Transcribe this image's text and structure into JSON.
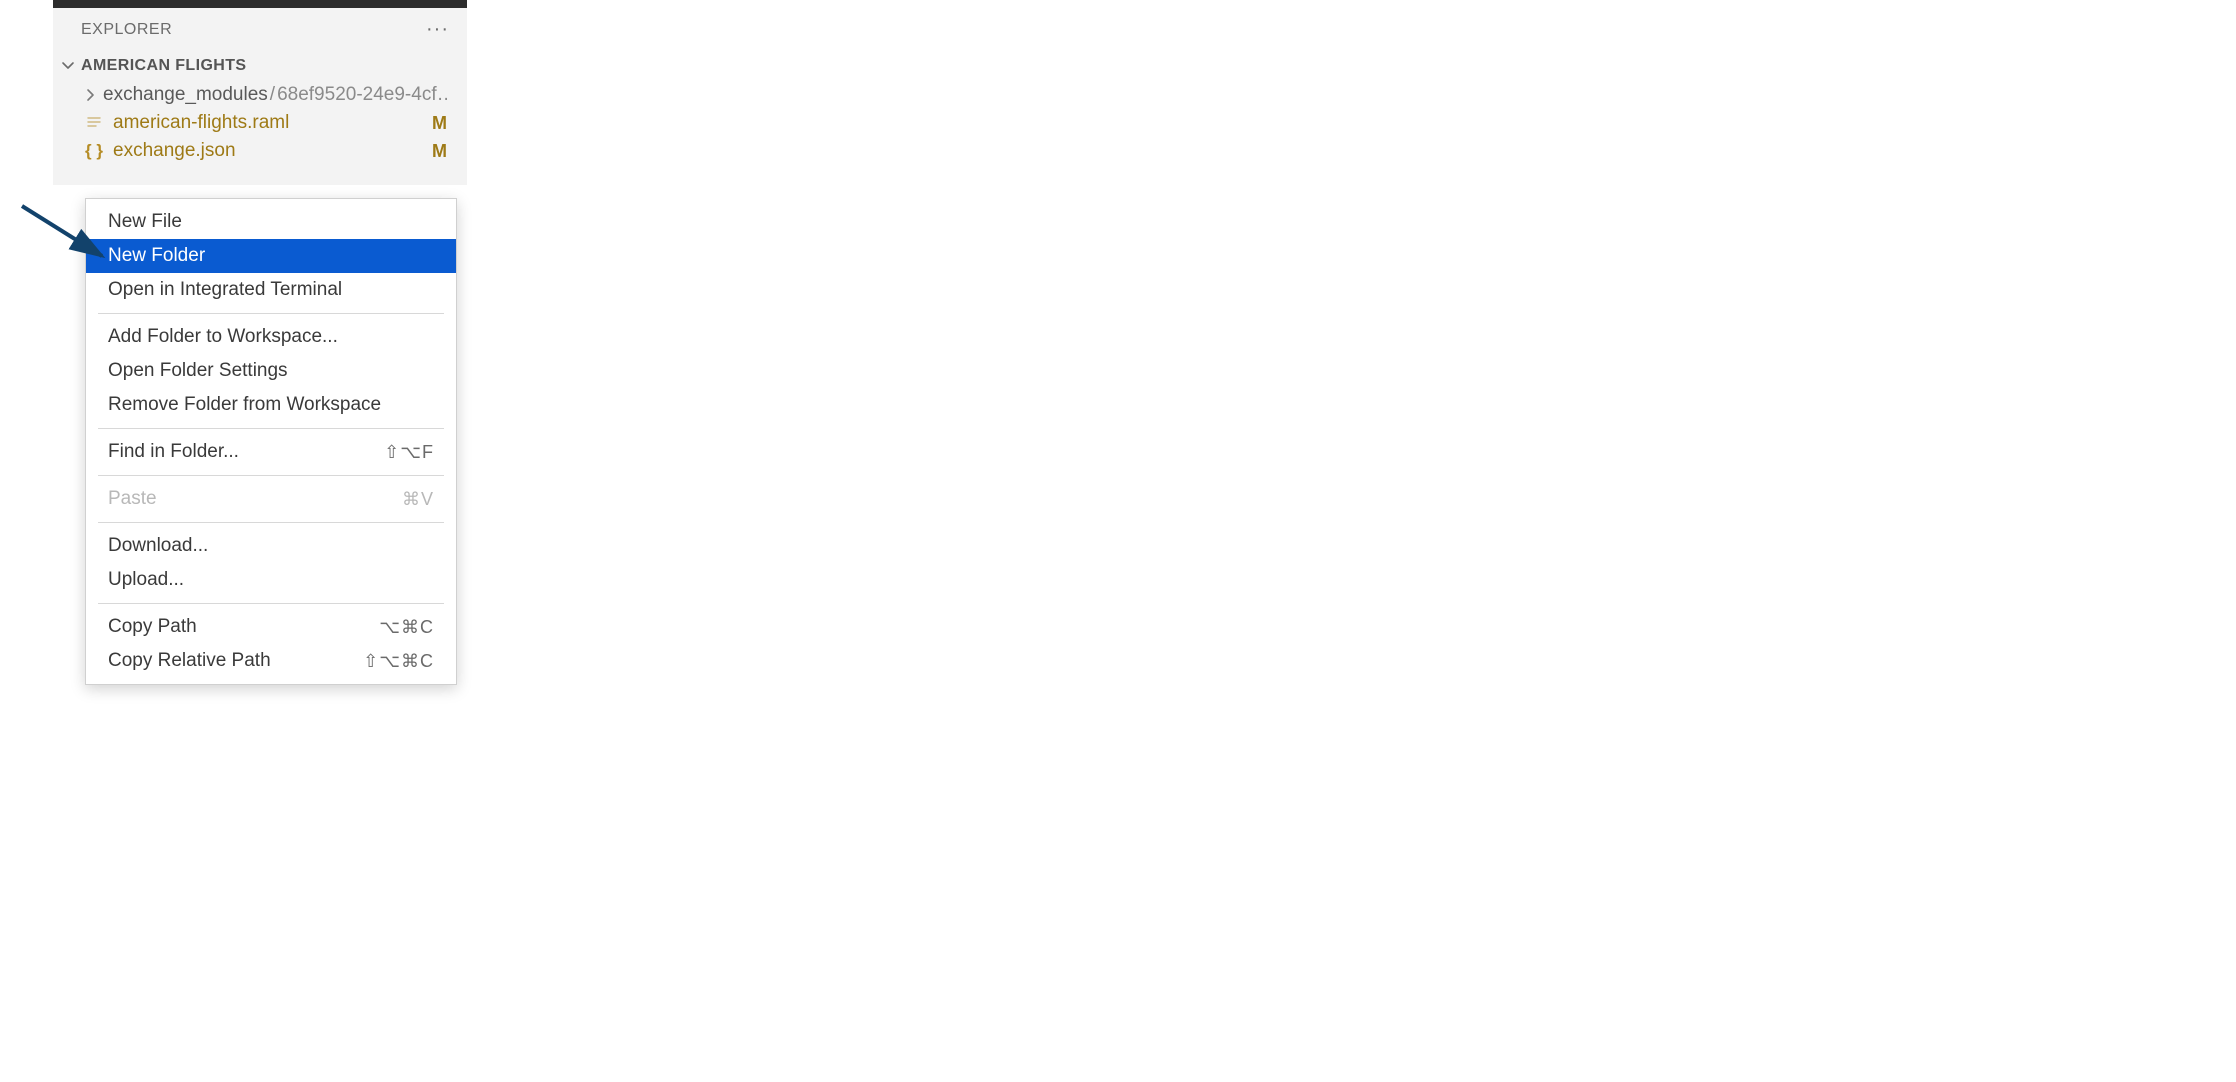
{
  "explorer": {
    "title": "EXPLORER",
    "project_name": "AMERICAN FLIGHTS",
    "tree": {
      "folder": {
        "name": "exchange_modules",
        "hash": "68ef9520-24e9-4cf…"
      },
      "files": [
        {
          "icon": "lines",
          "name": "american-flights.raml",
          "status": "M"
        },
        {
          "icon": "braces",
          "name": "exchange.json",
          "status": "M"
        }
      ]
    }
  },
  "context_menu": {
    "groups": [
      [
        {
          "label": "New File",
          "shortcut": "",
          "highlighted": false,
          "disabled": false
        },
        {
          "label": "New Folder",
          "shortcut": "",
          "highlighted": true,
          "disabled": false
        },
        {
          "label": "Open in Integrated Terminal",
          "shortcut": "",
          "highlighted": false,
          "disabled": false
        }
      ],
      [
        {
          "label": "Add Folder to Workspace...",
          "shortcut": "",
          "highlighted": false,
          "disabled": false
        },
        {
          "label": "Open Folder Settings",
          "shortcut": "",
          "highlighted": false,
          "disabled": false
        },
        {
          "label": "Remove Folder from Workspace",
          "shortcut": "",
          "highlighted": false,
          "disabled": false
        }
      ],
      [
        {
          "label": "Find in Folder...",
          "shortcut": "⇧⌥F",
          "highlighted": false,
          "disabled": false
        }
      ],
      [
        {
          "label": "Paste",
          "shortcut": "⌘V",
          "highlighted": false,
          "disabled": true
        }
      ],
      [
        {
          "label": "Download...",
          "shortcut": "",
          "highlighted": false,
          "disabled": false
        },
        {
          "label": "Upload...",
          "shortcut": "",
          "highlighted": false,
          "disabled": false
        }
      ],
      [
        {
          "label": "Copy Path",
          "shortcut": "⌥⌘C",
          "highlighted": false,
          "disabled": false
        },
        {
          "label": "Copy Relative Path",
          "shortcut": "⇧⌥⌘C",
          "highlighted": false,
          "disabled": false
        }
      ]
    ]
  },
  "annotation": {
    "arrow_color": "#12426b"
  }
}
